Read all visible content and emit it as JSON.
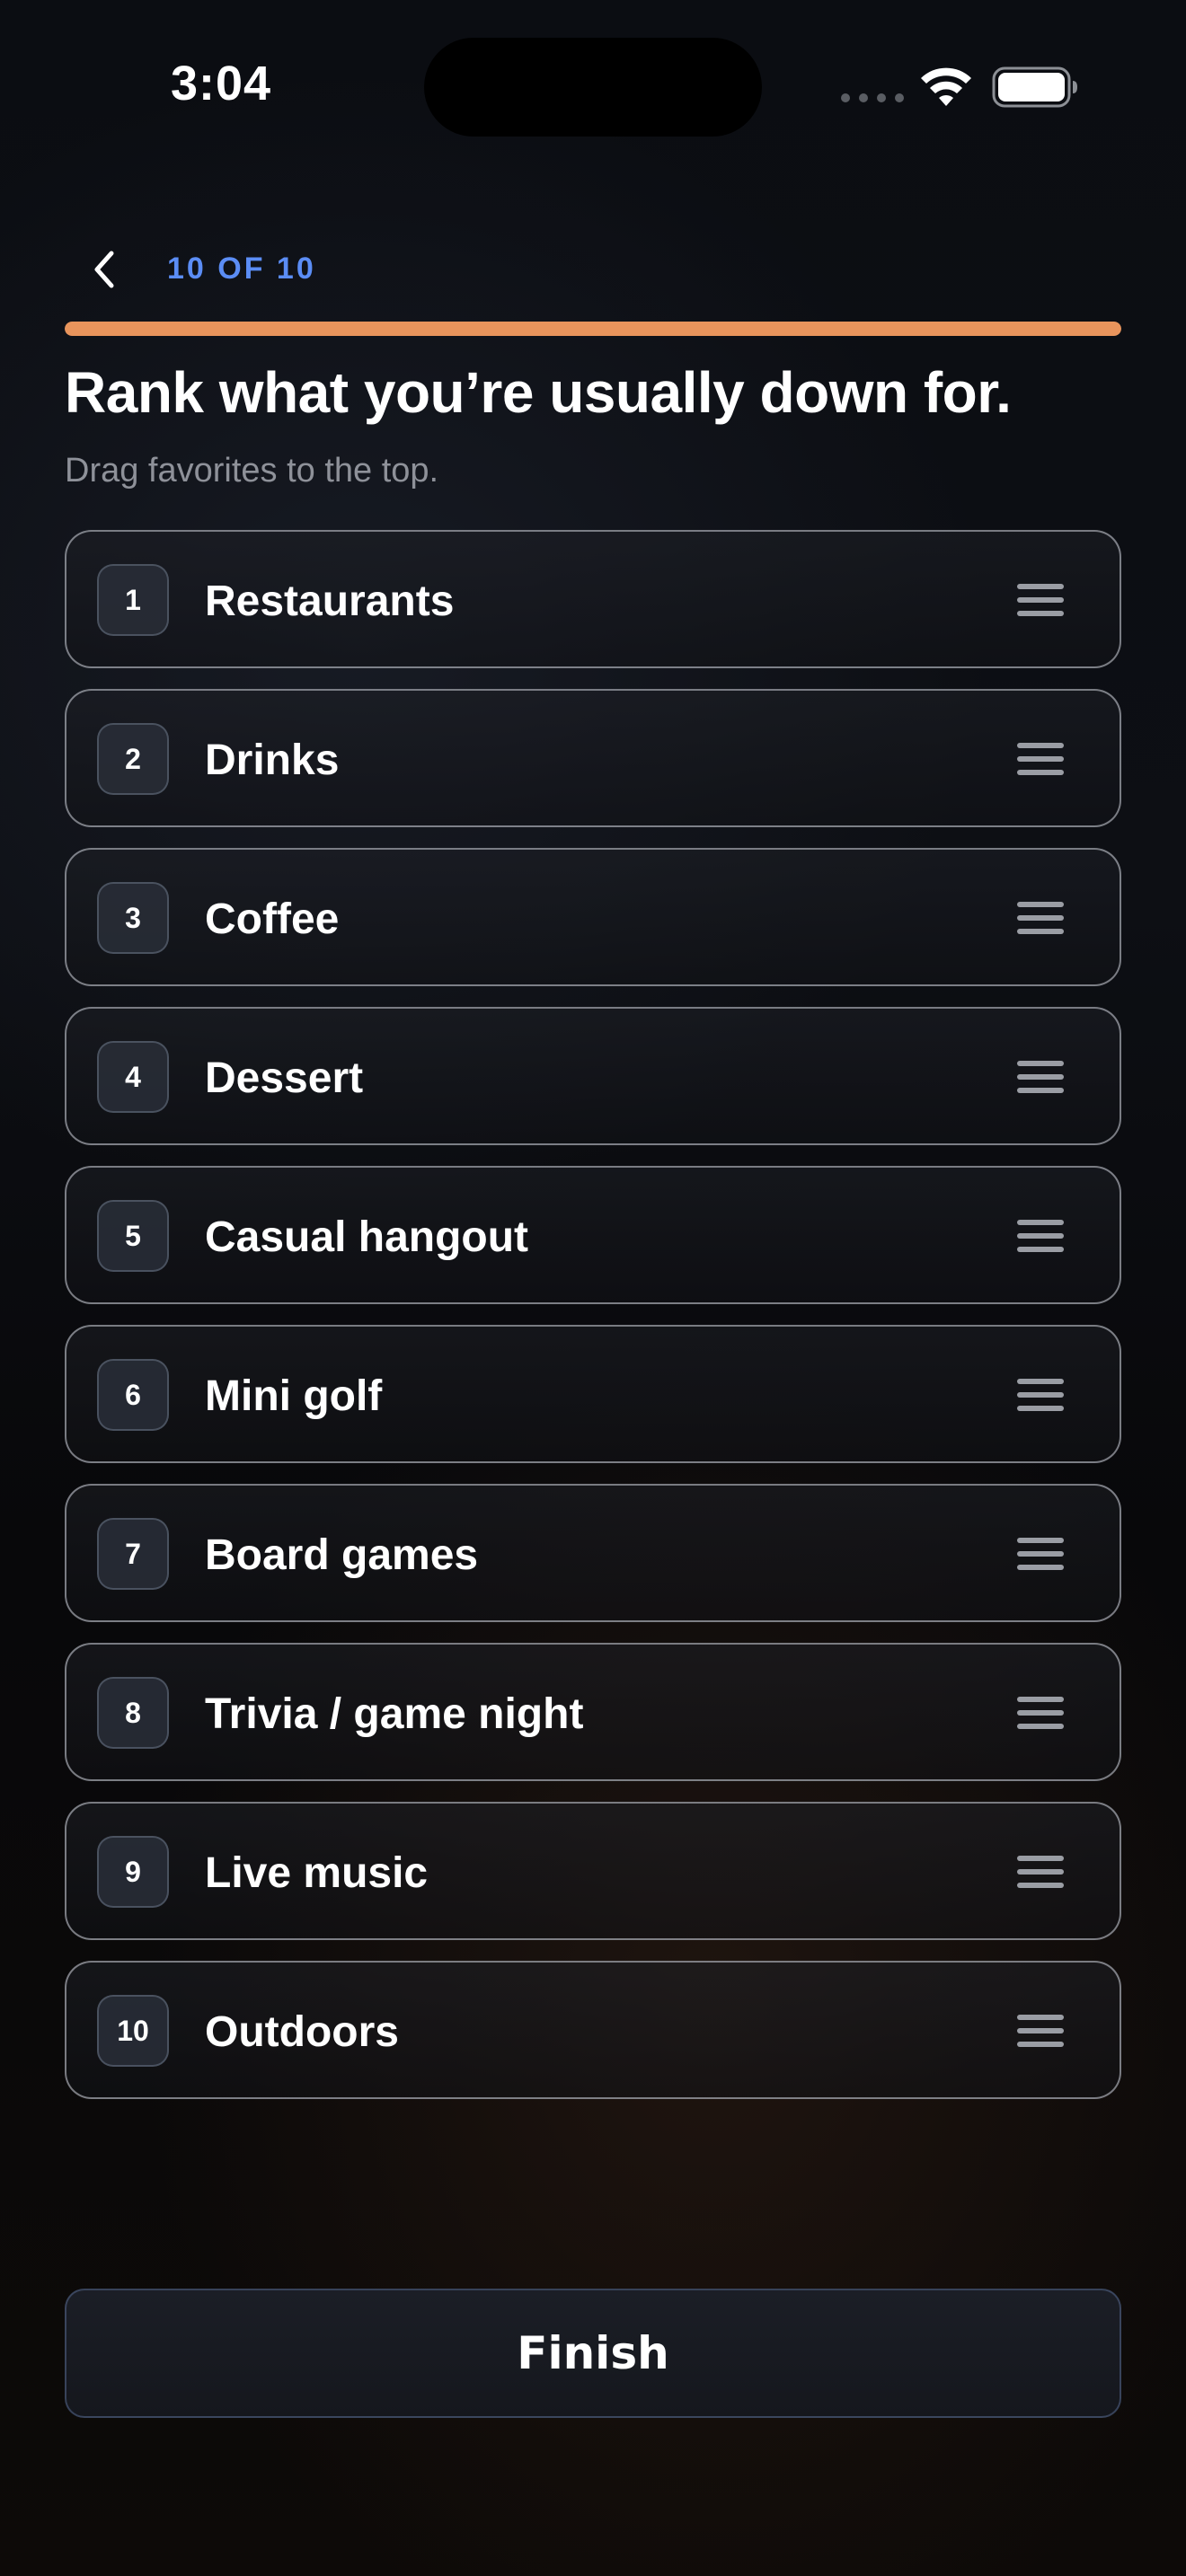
{
  "status_bar": {
    "time": "3:04"
  },
  "header": {
    "back_icon": "chevron-left-icon",
    "step_label": "10 OF 10",
    "progress_fraction": 1.0,
    "progress_color": "#e8945c"
  },
  "main": {
    "title": "Rank what you’re usually down for.",
    "subtitle": "Drag favorites to the top."
  },
  "rank_items": [
    {
      "rank": "1",
      "label": "Restaurants"
    },
    {
      "rank": "2",
      "label": "Drinks"
    },
    {
      "rank": "3",
      "label": "Coffee"
    },
    {
      "rank": "4",
      "label": "Dessert"
    },
    {
      "rank": "5",
      "label": "Casual hangout"
    },
    {
      "rank": "6",
      "label": "Mini golf"
    },
    {
      "rank": "7",
      "label": "Board games"
    },
    {
      "rank": "8",
      "label": "Trivia / game night"
    },
    {
      "rank": "9",
      "label": "Live music"
    },
    {
      "rank": "10",
      "label": "Outdoors"
    }
  ],
  "actions": {
    "finish_label": "Finish"
  },
  "colors": {
    "accent_blue": "#5b8df5",
    "accent_orange": "#e8945c",
    "background": "#0b0d12"
  }
}
